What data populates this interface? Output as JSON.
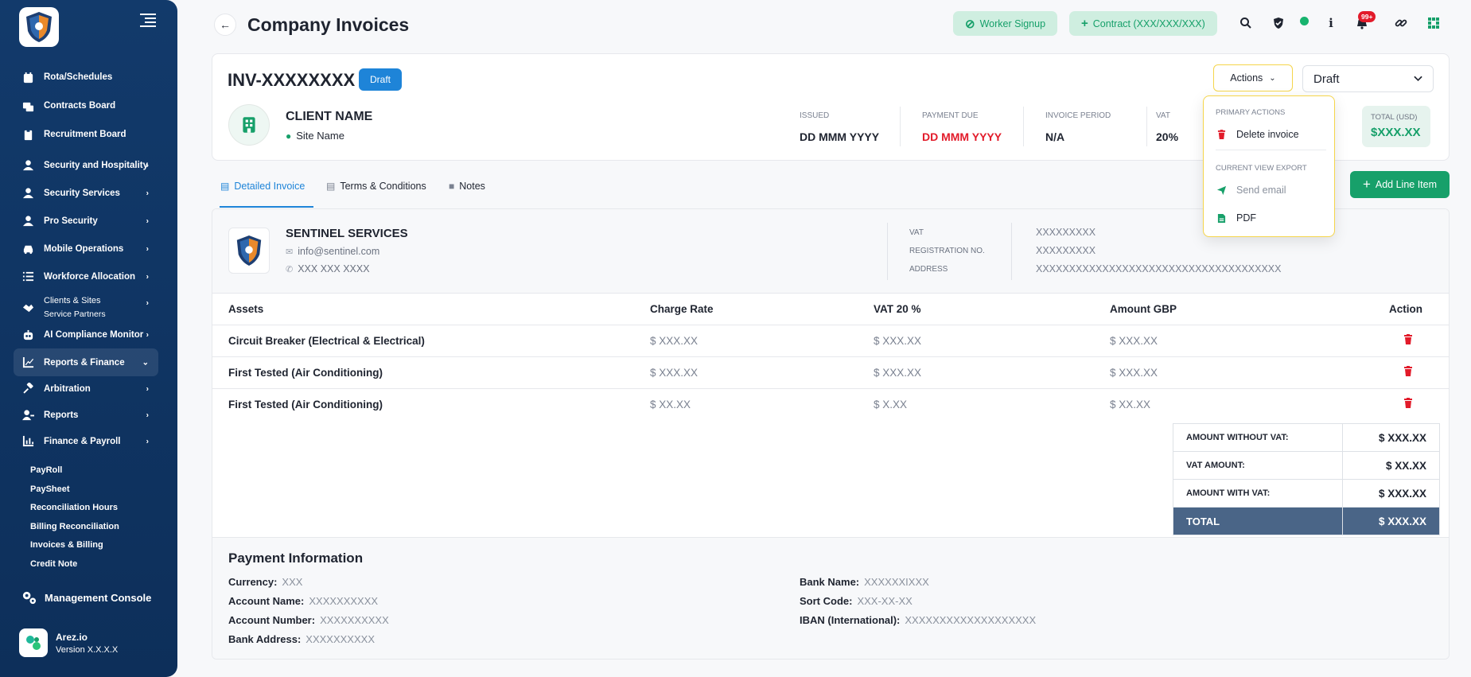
{
  "sidebar": {
    "items": [
      {
        "label": "Rota/Schedules",
        "icon": "calendar-icon",
        "chevron": false
      },
      {
        "label": "Contracts Board",
        "icon": "board-icon",
        "chevron": false
      },
      {
        "label": "Recruitment Board",
        "icon": "clipboard-icon",
        "chevron": false
      },
      {
        "label": "Security and Hospitality",
        "icon": "user-icon",
        "chevron": true
      },
      {
        "label": "Security Services",
        "icon": "user-icon",
        "chevron": true
      },
      {
        "label": "Pro Security",
        "icon": "user-icon",
        "chevron": true
      },
      {
        "label": "Mobile Operations",
        "icon": "car-icon",
        "chevron": true
      },
      {
        "label": "Workforce Allocation",
        "icon": "list-icon",
        "chevron": true
      },
      {
        "label": "Clients & Sites",
        "sub": "Service Partners",
        "icon": "handshake-icon",
        "chevron": true
      },
      {
        "label": "AI Compliance Monitor",
        "icon": "robot-icon",
        "chevron": true
      },
      {
        "label": "Reports & Finance",
        "icon": "chart-icon",
        "chevron": true,
        "active": true
      },
      {
        "label": "Arbitration",
        "icon": "gavel-icon",
        "chevron": true
      },
      {
        "label": "Reports",
        "icon": "user-report-icon",
        "chevron": true
      },
      {
        "label": "Finance & Payroll",
        "icon": "bar-chart-icon",
        "chevron": true
      }
    ],
    "subitems": [
      "PayRoll",
      "PaySheet",
      "Reconciliation Hours",
      "Billing Reconciliation",
      "Invoices & Billing",
      "Credit Note"
    ],
    "management": "Management Console",
    "app_name": "Arez.io",
    "version": "Version X.X.X.X"
  },
  "header": {
    "title": "Company Invoices",
    "worker_signup": "Worker Signup",
    "contract": "Contract (XXX/XXX/XXX)",
    "notifications_badge": "99+"
  },
  "invoice": {
    "number": "INV-XXXXXXXX",
    "status_badge": "Draft",
    "client_name": "CLIENT NAME",
    "site_name": "Site Name",
    "meta": [
      {
        "key": "ISSUED",
        "value": "DD MMM YYYY",
        "highlight": false
      },
      {
        "key": "PAYMENT DUE",
        "value": "DD MMM YYYY",
        "highlight": true
      },
      {
        "key": "INVOICE PERIOD",
        "value": "N/A",
        "highlight": false
      },
      {
        "key": "VAT",
        "value": "20%",
        "highlight": false
      }
    ],
    "total_label": "TOTAL (USD)",
    "total_value": "$XXX.XX",
    "actions_label": "Actions",
    "status_select": "Draft"
  },
  "actions_menu": {
    "primary_header": "PRIMARY ACTIONS",
    "delete": "Delete invoice",
    "export_header": "CURRENT VIEW EXPORT",
    "send_email": "Send email",
    "pdf": "PDF"
  },
  "tabs": [
    {
      "label": "Detailed Invoice",
      "active": true
    },
    {
      "label": "Terms & Conditions",
      "active": false
    },
    {
      "label": "Notes",
      "active": false
    }
  ],
  "add_line_item": "Add Line Item",
  "company": {
    "name": "SENTINEL SERVICES",
    "email": "info@sentinel.com",
    "phone": "XXX XXX XXXX",
    "vat_key": "VAT",
    "vat_value": "XXXXXXXXX",
    "reg_key": "REGISTRATION NO.",
    "reg_value": "XXXXXXXXX",
    "address_key": "ADDRESS",
    "address_value": "XXXXXXXXXXXXXXXXXXXXXXXXXXXXXXXXXXXXX"
  },
  "table": {
    "headers": [
      "Assets",
      "Charge Rate",
      "VAT 20 %",
      "Amount GBP",
      "Action"
    ],
    "rows": [
      {
        "asset": "Circuit Breaker (Electrical & Electrical)",
        "rate": "$ XXX.XX",
        "vat": "$ XXX.XX",
        "amount": "$ XXX.XX"
      },
      {
        "asset": "First Tested (Air Conditioning)",
        "rate": "$ XXX.XX",
        "vat": "$ XXX.XX",
        "amount": "$ XXX.XX"
      },
      {
        "asset": "First Tested (Air Conditioning)",
        "rate": "$ XX.XX",
        "vat": "$ X.XX",
        "amount": "$ XX.XX"
      }
    ]
  },
  "summary": [
    {
      "label": "AMOUNT WITHOUT VAT:",
      "value": "$ XXX.XX"
    },
    {
      "label": "VAT AMOUNT:",
      "value": "$ XX.XX"
    },
    {
      "label": "AMOUNT WITH VAT:",
      "value": "$ XXX.XX"
    },
    {
      "label": "TOTAL",
      "value": "$ XXX.XX"
    }
  ],
  "payment": {
    "title": "Payment Information",
    "left": [
      {
        "k": "Currency:",
        "v": "XXX"
      },
      {
        "k": "Account Name:",
        "v": "XXXXXXXXXX"
      },
      {
        "k": "Account Number:",
        "v": "XXXXXXXXXX"
      },
      {
        "k": "Bank Address:",
        "v": "XXXXXXXXXX"
      }
    ],
    "right": [
      {
        "k": "Bank Name:",
        "v": "XXXXXXIXXX"
      },
      {
        "k": "Sort Code:",
        "v": "XXX-XX-XX"
      },
      {
        "k": "IBAN (International):",
        "v": "XXXXXXXXXXXXXXXXXXX"
      }
    ]
  },
  "colors": {
    "sidebar": "#123a6b",
    "accent_green": "#17a06a",
    "accent_blue": "#1e84d8",
    "danger": "#e21b2a"
  }
}
